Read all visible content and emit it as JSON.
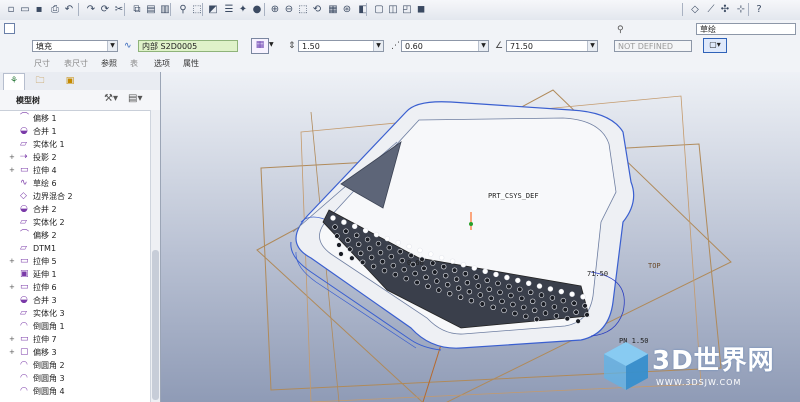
{
  "toolbar": {
    "buttons": [
      "new-icon",
      "open-icon",
      "save-icon",
      "print-icon",
      "undo-icon",
      "redo-icon",
      "regenerate-icon",
      "cut-icon",
      "copy-icon",
      "paste-icon",
      "paste-special-icon",
      "find-icon",
      "select-box-icon",
      "datum-display-icon",
      "layer-icon",
      "appearance-icon",
      "sphere-icon",
      "zoom-in-icon",
      "zoom-out-icon",
      "refit-icon",
      "reorient-icon",
      "saved-views-icon",
      "spin-center-icon",
      "display-style-icon",
      "wireframe-icon",
      "hidden-line-icon",
      "no-hidden-icon",
      "shading-icon",
      "plane-icon",
      "axis-icon",
      "point-icon",
      "csys-icon",
      "help-icon"
    ]
  },
  "dashboard": {
    "fill_type": "填充",
    "sketch_name": "内部 S2D0005",
    "value_1": "1.50",
    "value_2": "0.60",
    "angle": "71.50",
    "undefined_value": "NOT DEFINED",
    "pattern_label": "草绘",
    "tabs": [
      {
        "label": "尺寸",
        "dim": true
      },
      {
        "label": "表尺寸",
        "dim": true
      },
      {
        "label": "参照",
        "dim": false
      },
      {
        "label": "表",
        "dim": true
      },
      {
        "label": "选项",
        "dim": false
      },
      {
        "label": "属性",
        "dim": false
      }
    ]
  },
  "panel": {
    "title": "模型树",
    "items": [
      {
        "label": "偏移 1",
        "expand": false
      },
      {
        "label": "合并 1",
        "expand": false
      },
      {
        "label": "实体化 1",
        "expand": false
      },
      {
        "label": "投影 2",
        "expand": true
      },
      {
        "label": "拉伸 4",
        "expand": true
      },
      {
        "label": "草绘 6",
        "expand": false
      },
      {
        "label": "边界混合 2",
        "expand": false
      },
      {
        "label": "合并 2",
        "expand": false
      },
      {
        "label": "实体化 2",
        "expand": false
      },
      {
        "label": "偏移 2",
        "expand": false
      },
      {
        "label": "DTM1",
        "expand": false
      },
      {
        "label": "拉伸 5",
        "expand": true
      },
      {
        "label": "延伸 1",
        "expand": false
      },
      {
        "label": "拉伸 6",
        "expand": true
      },
      {
        "label": "合并 3",
        "expand": false
      },
      {
        "label": "实体化 3",
        "expand": false
      },
      {
        "label": "倒圆角 1",
        "expand": false
      },
      {
        "label": "拉伸 7",
        "expand": true
      },
      {
        "label": "偏移 3",
        "expand": true
      },
      {
        "label": "倒圆角 2",
        "expand": false
      },
      {
        "label": "倒圆角 3",
        "expand": false
      },
      {
        "label": "倒圆角 4",
        "expand": false
      }
    ]
  },
  "viewport": {
    "labels": {
      "csys": "PRT_CSYS_DEF",
      "dim_a": "0.60",
      "dim_b": "71.50",
      "dim_c": "PN 1.50",
      "top": "TOP"
    }
  },
  "watermark": {
    "brand": "3D世界网",
    "url": "WWW.3DSJW.COM"
  },
  "colors": {
    "accent": "#2f62b8",
    "sketch_green": "#dff2c9"
  }
}
